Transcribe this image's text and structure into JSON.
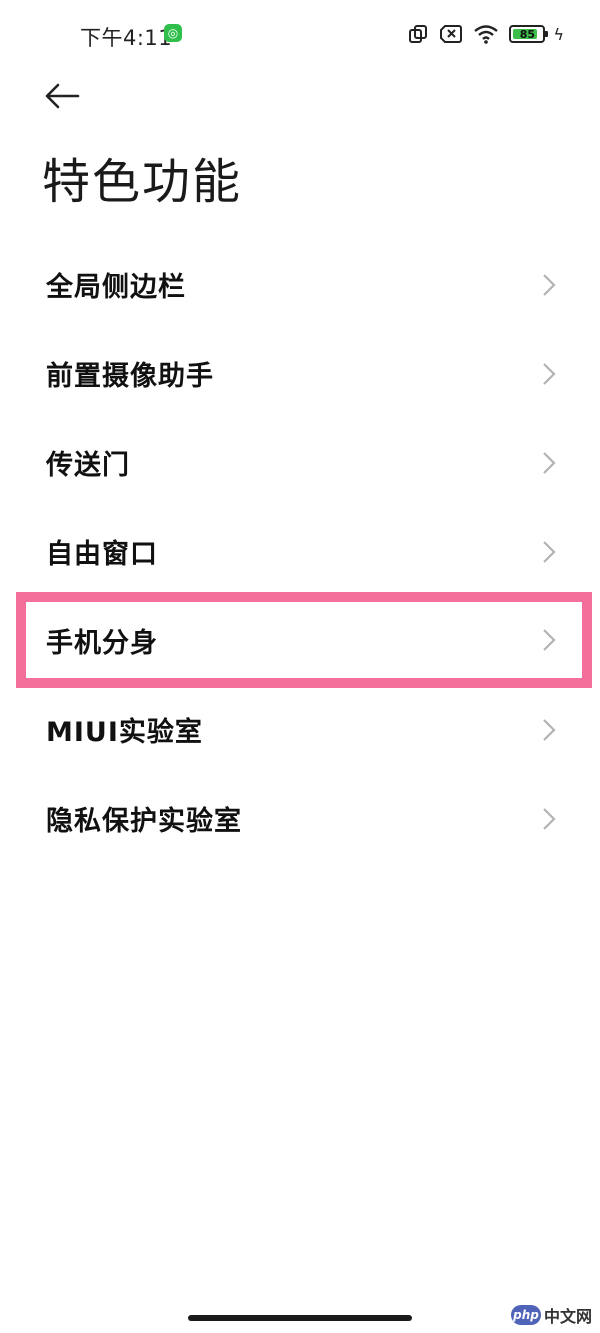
{
  "status_bar": {
    "time": "下午4:11",
    "battery_percent": "85",
    "battery_level": 0.85,
    "icons": [
      "app-notification-icon",
      "screen-rotate-icon",
      "no-sim-icon",
      "wifi-icon",
      "battery-icon",
      "charging-icon"
    ]
  },
  "header": {
    "back_icon": "back-arrow-icon",
    "title": "特色功能"
  },
  "list": {
    "items": [
      {
        "label": "全局侧边栏"
      },
      {
        "label": "前置摄像助手"
      },
      {
        "label": "传送门"
      },
      {
        "label": "自由窗口"
      },
      {
        "label": "手机分身",
        "highlighted": true
      },
      {
        "label": "MIUI实验室"
      },
      {
        "label": "隐私保护实验室"
      }
    ]
  },
  "watermark": {
    "logo": "php",
    "text": "中文网"
  },
  "colors": {
    "highlight": "#f4709a",
    "battery_fill": "#3cc04a",
    "chevron": "#b3b3b3"
  }
}
